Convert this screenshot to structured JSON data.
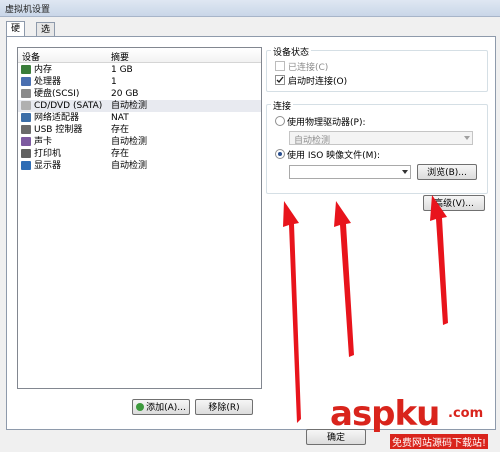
{
  "window": {
    "title": "虚拟机设置"
  },
  "tabs": [
    {
      "label": "硬件"
    },
    {
      "label": "选项"
    }
  ],
  "device_list": {
    "headers": {
      "device": "设备",
      "summary": "摘要"
    },
    "rows": [
      {
        "name": "内存",
        "summary": "1 GB",
        "icon": "memory-icon",
        "color": "#3a7d3a"
      },
      {
        "name": "处理器",
        "summary": "1",
        "icon": "cpu-icon",
        "color": "#4a6fb0"
      },
      {
        "name": "硬盘(SCSI)",
        "summary": "20 GB",
        "icon": "harddisk-icon",
        "color": "#8a8a8a"
      },
      {
        "name": "CD/DVD (SATA)",
        "summary": "自动检测",
        "icon": "cd-dvd-icon",
        "color": "#b0b0b0"
      },
      {
        "name": "网络适配器",
        "summary": "NAT",
        "icon": "network-adapter-icon",
        "color": "#3b6ea8"
      },
      {
        "name": "USB 控制器",
        "summary": "存在",
        "icon": "usb-icon",
        "color": "#6a6a6a"
      },
      {
        "name": "声卡",
        "summary": "自动检测",
        "icon": "sound-card-icon",
        "color": "#7d5aa0"
      },
      {
        "name": "打印机",
        "summary": "存在",
        "icon": "printer-icon",
        "color": "#606060"
      },
      {
        "name": "显示器",
        "summary": "自动检测",
        "icon": "monitor-icon",
        "color": "#2f6db5"
      }
    ],
    "selected_index": 3
  },
  "buttons": {
    "add": "添加(A)...",
    "remove": "移除(R)",
    "browse": "浏览(B)...",
    "advanced": "高级(V)...",
    "ok": "确定"
  },
  "device_status": {
    "title": "设备状态",
    "connected": {
      "label": "已连接(C)",
      "checked": false
    },
    "connect_at_power_on": {
      "label": "启动时连接(O)",
      "checked": true
    }
  },
  "connection": {
    "title": "连接",
    "physical": {
      "label": "使用物理驱动器(P):",
      "selected": false,
      "value": "自动检测"
    },
    "iso": {
      "label": "使用 ISO 映像文件(M):",
      "selected": true,
      "value": ""
    }
  },
  "watermark": {
    "brand": "aspku",
    "dotcom": ".com",
    "tagline": "免费网站源码下载站!"
  },
  "colors": {
    "arrow": "#e8141c",
    "watermark": "#d9241c"
  }
}
